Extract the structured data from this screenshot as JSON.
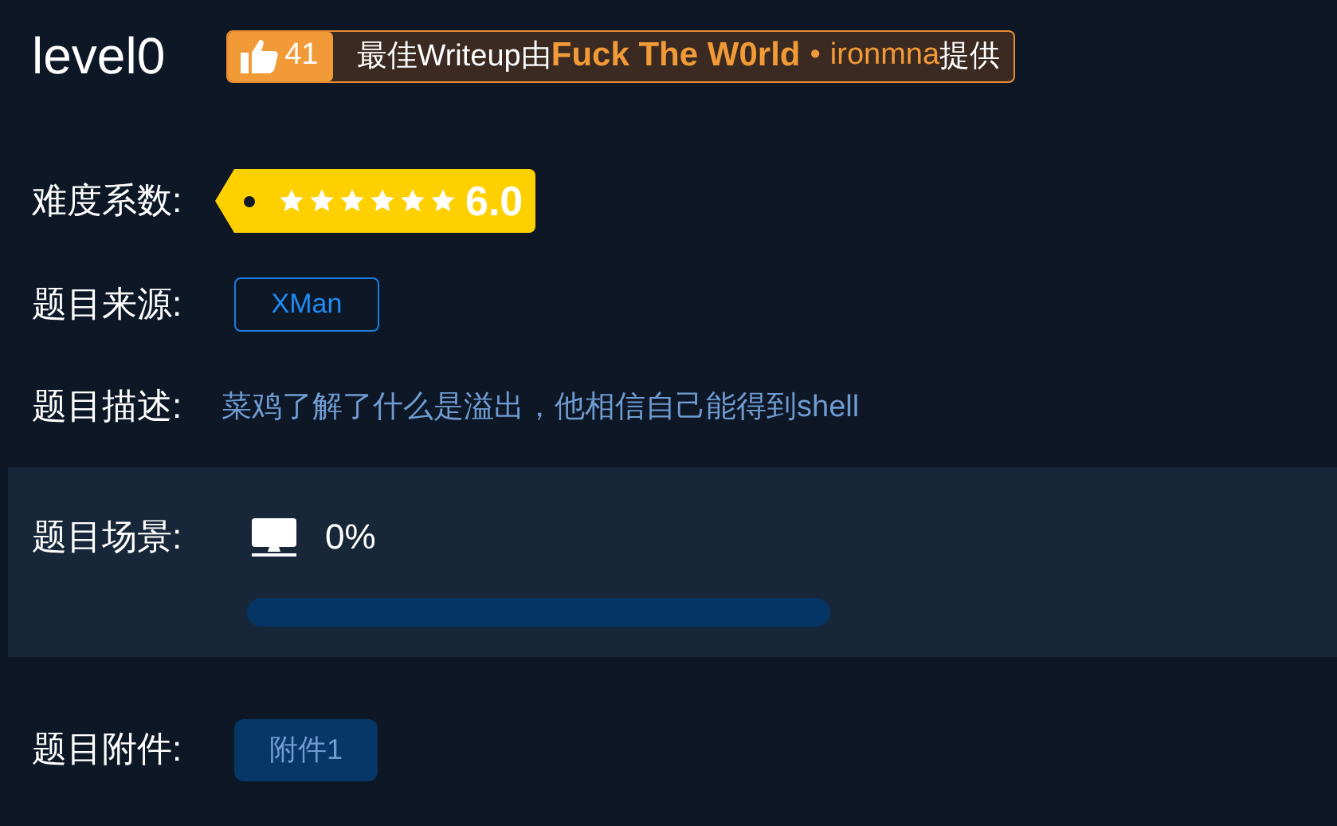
{
  "title": "level0",
  "writeup": {
    "likes": "41",
    "prefix": "最佳Writeup由",
    "team": "Fuck The W0rld",
    "separator": "•",
    "author": "ironmna",
    "suffix": "提供"
  },
  "difficulty": {
    "label": "难度系数:",
    "stars": 6,
    "score": "6.0"
  },
  "source": {
    "label": "题目来源:",
    "value": "XMan"
  },
  "description": {
    "label": "题目描述:",
    "text": "菜鸡了解了什么是溢出，他相信自己能得到shell"
  },
  "scene": {
    "label": "题目场景:",
    "percent": "0%",
    "level": 0
  },
  "attachments": {
    "label": "题目附件:",
    "files": [
      "附件1"
    ]
  }
}
